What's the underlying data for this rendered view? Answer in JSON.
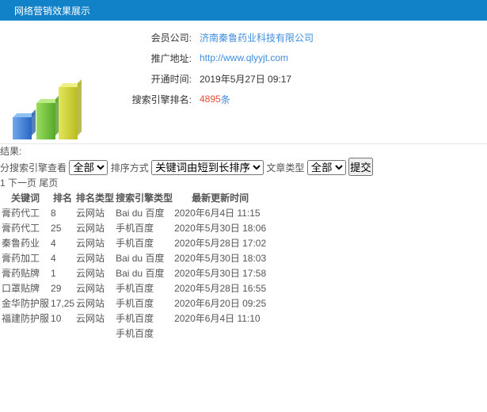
{
  "header": {
    "title": "网络营销效果展示"
  },
  "info": {
    "rows": [
      {
        "label": "会员公司:",
        "value": "济南秦鲁药业科技有限公司",
        "type": "link"
      },
      {
        "label": "推广地址:",
        "value": "http://www.qlyyjt.com",
        "type": "link"
      },
      {
        "label": "开通时间:",
        "value": "2019年5月27日 09:17",
        "type": "text"
      },
      {
        "label": "搜索引擎排名:",
        "value": "4895",
        "suffix": "条",
        "type": "highlight"
      }
    ]
  },
  "filters": {
    "result_label": "结果:",
    "engine_label": "分搜索引擎查看",
    "engine_value": "全部",
    "sort_label": "排序方式",
    "sort_value": "关键词由短到长排序",
    "article_label": "文章类型",
    "article_value": "全部",
    "submit_label": "提交"
  },
  "pagination": {
    "current": "1",
    "next": "下一页",
    "last": "尾页"
  },
  "table": {
    "headers": [
      "关键词",
      "排名",
      "排名类型",
      "搜索引擎类型",
      "最新更新时间"
    ],
    "baidu_logo": {
      "bai": "Bai",
      "du": "du",
      "cn": "百度"
    },
    "mobile_label": "手机百度",
    "rows": [
      {
        "keyword": "膏药代工",
        "rank": "8",
        "rank_type": "云网站",
        "engine": "baidu",
        "updated": "2020年6月4日 11:15"
      },
      {
        "keyword": "膏药代工",
        "rank": "25",
        "rank_type": "云网站",
        "engine": "mobile",
        "updated": "2020年5月30日 18:06"
      },
      {
        "keyword": "秦鲁药业",
        "rank": "4",
        "rank_type": "云网站",
        "engine": "mobile",
        "updated": "2020年5月28日 17:02"
      },
      {
        "keyword": "膏药加工",
        "rank": "4",
        "rank_type": "云网站",
        "engine": "baidu",
        "updated": "2020年5月30日 18:03"
      },
      {
        "keyword": "膏药贴牌",
        "rank": "1",
        "rank_type": "云网站",
        "engine": "baidu",
        "updated": "2020年5月30日 17:58"
      },
      {
        "keyword": "口罩贴牌",
        "rank": "29",
        "rank_type": "云网站",
        "engine": "mobile",
        "updated": "2020年5月28日 16:55"
      },
      {
        "keyword": "金华防护服",
        "rank": "17,25",
        "rank_type": "云网站",
        "engine": "mobile",
        "updated": "2020年6月20日 09:25"
      },
      {
        "keyword": "福建防护服",
        "rank": "10",
        "rank_type": "云网站",
        "engine": "mobile",
        "updated": "2020年6月4日 11:10"
      },
      {
        "keyword": "",
        "rank": "",
        "rank_type": "",
        "engine": "mobile",
        "updated": ""
      }
    ]
  },
  "colors": {
    "header_bg": "#1181c8",
    "link_blue": "#3e8ede",
    "highlight_red": "#e4503a",
    "pager_active": "#2e6da4",
    "baidu_blue": "#2319dc",
    "baidu_red": "#de0f17"
  }
}
